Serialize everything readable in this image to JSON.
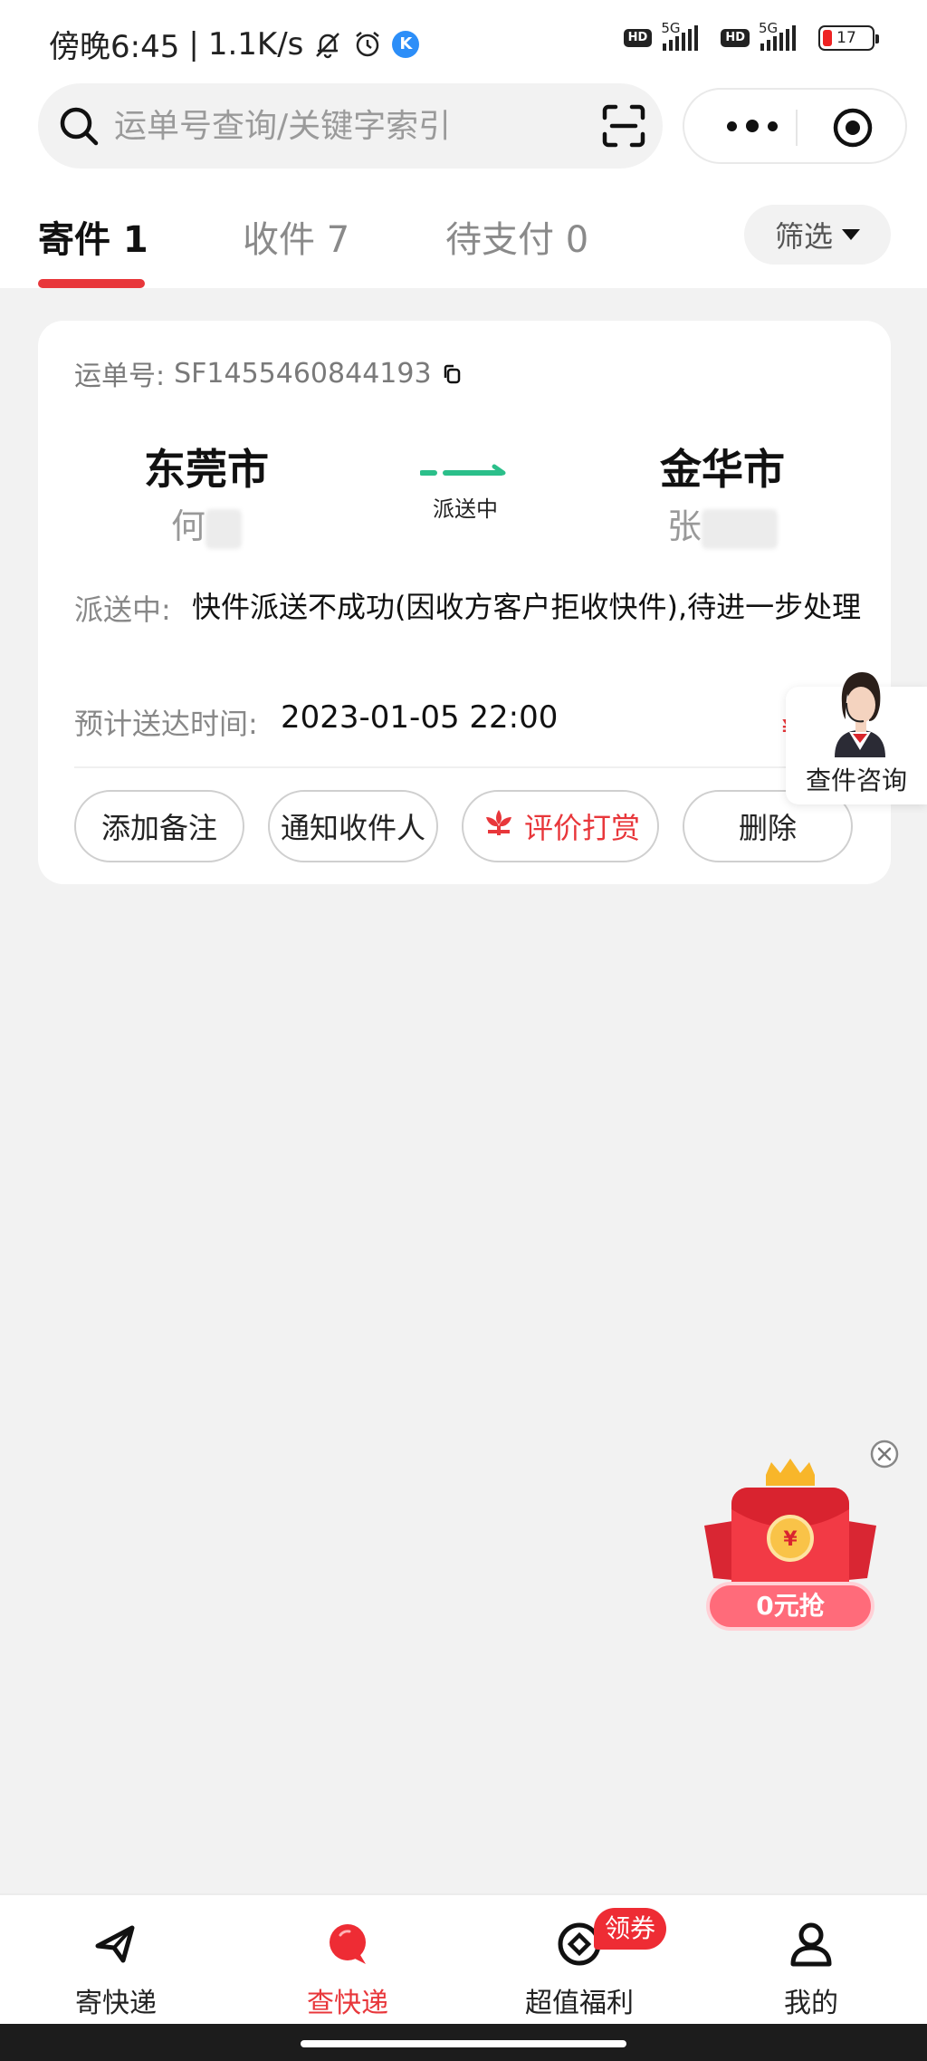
{
  "status_bar": {
    "time": "傍晚6:45",
    "speed": "1.1K/s",
    "network1": "5G",
    "network2": "5G",
    "hd1": "HD",
    "hd2": "HD",
    "battery": "17",
    "app_badge": "K"
  },
  "search": {
    "placeholder": "运单号查询/关键字索引"
  },
  "tabs": [
    {
      "label": "寄件 1",
      "active": true
    },
    {
      "label": "收件 7",
      "active": false
    },
    {
      "label": "待支付 0",
      "active": false
    }
  ],
  "filter": {
    "label": "筛选"
  },
  "shipment": {
    "waybill_label": "运单号:",
    "waybill_number": "SF1455460844193",
    "from_city": "东莞市",
    "from_person": "何",
    "to_city": "金华市",
    "to_person": "张",
    "route_status": "派送中",
    "status_label": "派送中:",
    "status_text": "快件派送不成功(因收方客户拒收快件),待进一步处理",
    "eta_label": "预计送达时间:",
    "eta_value": "2023-01-05 22:00",
    "red_mark": "¥"
  },
  "actions": {
    "add_note": "添加备注",
    "notify_receiver": "通知收件人",
    "rate_reward": "评价打赏",
    "delete": "删除"
  },
  "consult": {
    "label": "查件咨询"
  },
  "promo": {
    "label": "0元抢",
    "coin": "¥"
  },
  "bottom_nav": [
    {
      "label": "寄快递",
      "icon": "send-icon",
      "active": false
    },
    {
      "label": "查快递",
      "icon": "track-icon",
      "active": true
    },
    {
      "label": "超值福利",
      "icon": "benefits-icon",
      "active": false
    },
    {
      "label": "我的",
      "icon": "profile-icon",
      "active": false
    }
  ],
  "coupon_badge": "领券",
  "colors": {
    "accent": "#e8373b",
    "route_green": "#2bbf8a",
    "background": "#f2f2f2"
  }
}
